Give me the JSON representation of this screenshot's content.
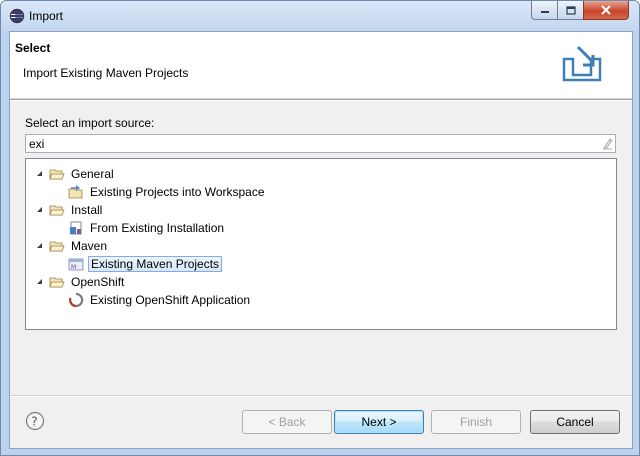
{
  "window": {
    "title": "Import"
  },
  "header": {
    "title": "Select",
    "description": "Import Existing Maven Projects"
  },
  "source": {
    "label": "Select an import source:",
    "filter_value": "exi"
  },
  "tree": {
    "groups": [
      {
        "label": "General",
        "children": [
          {
            "label": "Existing Projects into Workspace",
            "icon": "projects-import-icon"
          }
        ]
      },
      {
        "label": "Install",
        "children": [
          {
            "label": "From Existing Installation",
            "icon": "installation-icon"
          }
        ]
      },
      {
        "label": "Maven",
        "children": [
          {
            "label": "Existing Maven Projects",
            "icon": "maven-icon",
            "selected": true
          }
        ]
      },
      {
        "label": "OpenShift",
        "children": [
          {
            "label": "Existing OpenShift Application",
            "icon": "openshift-icon"
          }
        ]
      }
    ]
  },
  "buttons": {
    "back": "< Back",
    "next": "Next >",
    "finish": "Finish",
    "cancel": "Cancel"
  }
}
